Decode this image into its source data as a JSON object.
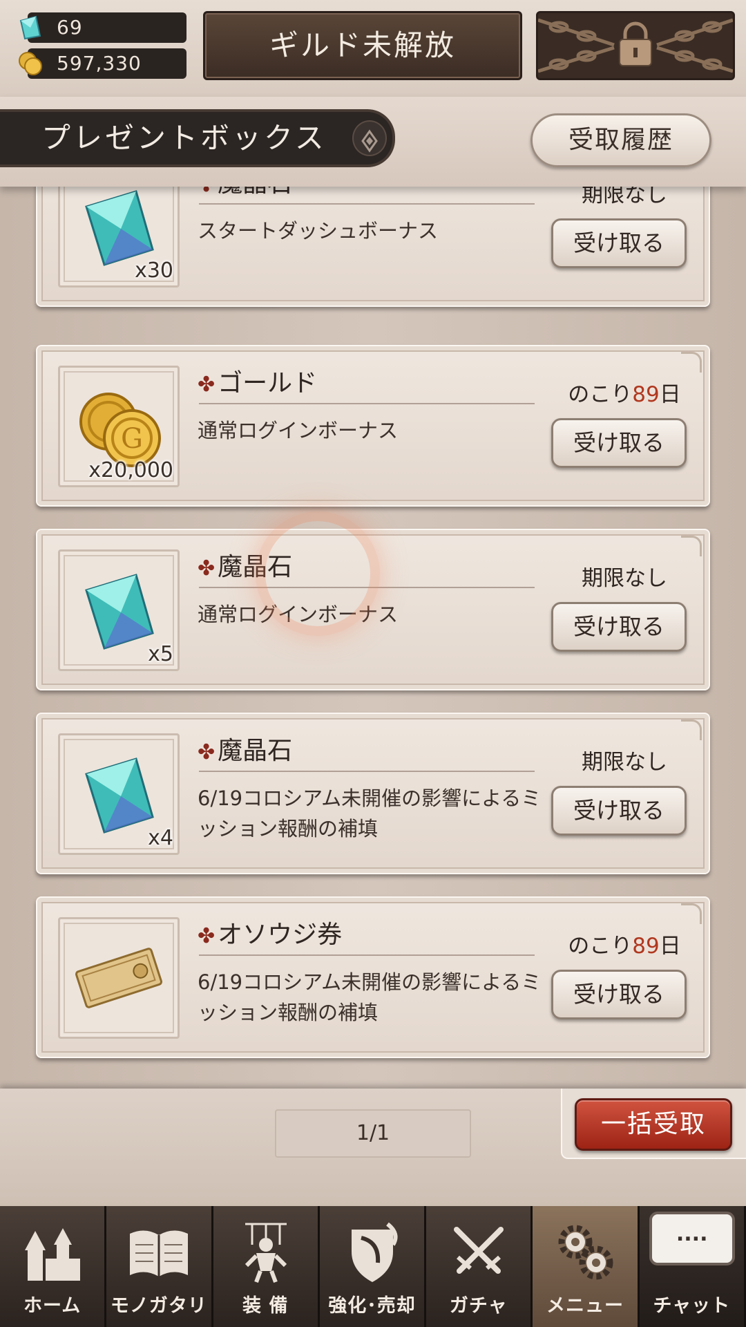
{
  "resources": {
    "gems": "69",
    "gold": "597,330"
  },
  "guild_button": "ギルド未解放",
  "header": {
    "title": "プレゼントボックス",
    "history_button": "受取履歴"
  },
  "items": [
    {
      "name": "魔晶石",
      "quantity": "x30",
      "description": "スタートダッシュボーナス",
      "expiry_text": "期限なし",
      "expiry_prefix": "",
      "expiry_days": "",
      "expiry_suffix": "",
      "button": "受け取る",
      "icon": "crystal-icon"
    },
    {
      "name": "ゴールド",
      "quantity": "x20,000",
      "description": "通常ログインボーナス",
      "expiry_text": "",
      "expiry_prefix": "のこり",
      "expiry_days": "89",
      "expiry_suffix": "日",
      "button": "受け取る",
      "icon": "gold-coins-icon"
    },
    {
      "name": "魔晶石",
      "quantity": "x5",
      "description": "通常ログインボーナス",
      "expiry_text": "期限なし",
      "expiry_prefix": "",
      "expiry_days": "",
      "expiry_suffix": "",
      "button": "受け取る",
      "icon": "crystal-icon"
    },
    {
      "name": "魔晶石",
      "quantity": "x4",
      "description": "6/19コロシアム未開催の影響によるミッション報酬の補填",
      "expiry_text": "期限なし",
      "expiry_prefix": "",
      "expiry_days": "",
      "expiry_suffix": "",
      "button": "受け取る",
      "icon": "crystal-icon"
    },
    {
      "name": "オソウジ券",
      "quantity": "",
      "description": "6/19コロシアム未開催の影響によるミッション報酬の補填",
      "expiry_text": "",
      "expiry_prefix": "のこり",
      "expiry_days": "89",
      "expiry_suffix": "日",
      "button": "受け取る",
      "icon": "ticket-icon"
    }
  ],
  "bullet": "✤",
  "footer": {
    "pagination": "1/1",
    "bulk_receive": "一括受取"
  },
  "nav": [
    {
      "label": "ホーム",
      "icon": "castle-icon"
    },
    {
      "label": "モノガタリ",
      "icon": "book-icon"
    },
    {
      "label": "装 備",
      "icon": "puppet-icon"
    },
    {
      "label": "強化･売却",
      "icon": "shield-icon"
    },
    {
      "label": "ガチャ",
      "icon": "swords-icon"
    },
    {
      "label": "メニュー",
      "icon": "gears-icon"
    },
    {
      "label": "チャット",
      "icon": "chat-bubble-icon"
    }
  ],
  "chat_dots": "....",
  "colors": {
    "accent_red": "#b0381f",
    "bulk_button": "#b8382a",
    "nav_active": "#8b735c"
  }
}
